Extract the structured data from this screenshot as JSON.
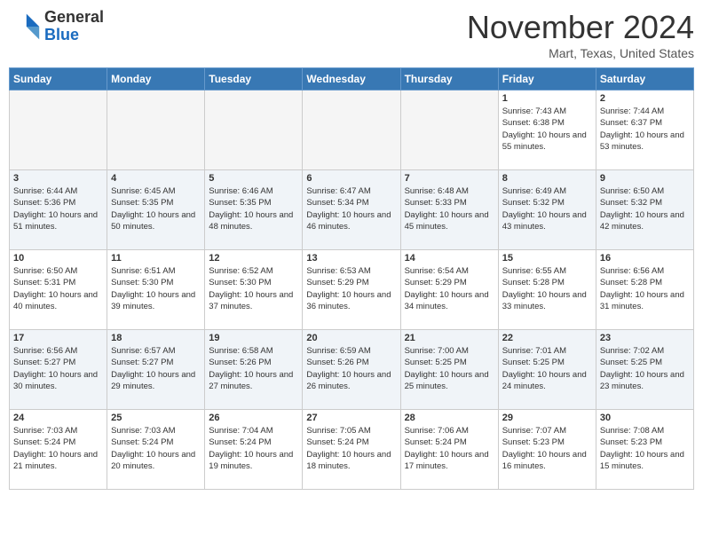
{
  "header": {
    "logo_general": "General",
    "logo_blue": "Blue",
    "month_title": "November 2024",
    "location": "Mart, Texas, United States"
  },
  "days_of_week": [
    "Sunday",
    "Monday",
    "Tuesday",
    "Wednesday",
    "Thursday",
    "Friday",
    "Saturday"
  ],
  "weeks": [
    [
      {
        "day": "",
        "empty": true
      },
      {
        "day": "",
        "empty": true
      },
      {
        "day": "",
        "empty": true
      },
      {
        "day": "",
        "empty": true
      },
      {
        "day": "",
        "empty": true
      },
      {
        "day": "1",
        "sunrise": "7:43 AM",
        "sunset": "6:38 PM",
        "daylight": "10 hours and 55 minutes."
      },
      {
        "day": "2",
        "sunrise": "7:44 AM",
        "sunset": "6:37 PM",
        "daylight": "10 hours and 53 minutes."
      }
    ],
    [
      {
        "day": "3",
        "sunrise": "6:44 AM",
        "sunset": "5:36 PM",
        "daylight": "10 hours and 51 minutes."
      },
      {
        "day": "4",
        "sunrise": "6:45 AM",
        "sunset": "5:35 PM",
        "daylight": "10 hours and 50 minutes."
      },
      {
        "day": "5",
        "sunrise": "6:46 AM",
        "sunset": "5:35 PM",
        "daylight": "10 hours and 48 minutes."
      },
      {
        "day": "6",
        "sunrise": "6:47 AM",
        "sunset": "5:34 PM",
        "daylight": "10 hours and 46 minutes."
      },
      {
        "day": "7",
        "sunrise": "6:48 AM",
        "sunset": "5:33 PM",
        "daylight": "10 hours and 45 minutes."
      },
      {
        "day": "8",
        "sunrise": "6:49 AM",
        "sunset": "5:32 PM",
        "daylight": "10 hours and 43 minutes."
      },
      {
        "day": "9",
        "sunrise": "6:50 AM",
        "sunset": "5:32 PM",
        "daylight": "10 hours and 42 minutes."
      }
    ],
    [
      {
        "day": "10",
        "sunrise": "6:50 AM",
        "sunset": "5:31 PM",
        "daylight": "10 hours and 40 minutes."
      },
      {
        "day": "11",
        "sunrise": "6:51 AM",
        "sunset": "5:30 PM",
        "daylight": "10 hours and 39 minutes."
      },
      {
        "day": "12",
        "sunrise": "6:52 AM",
        "sunset": "5:30 PM",
        "daylight": "10 hours and 37 minutes."
      },
      {
        "day": "13",
        "sunrise": "6:53 AM",
        "sunset": "5:29 PM",
        "daylight": "10 hours and 36 minutes."
      },
      {
        "day": "14",
        "sunrise": "6:54 AM",
        "sunset": "5:29 PM",
        "daylight": "10 hours and 34 minutes."
      },
      {
        "day": "15",
        "sunrise": "6:55 AM",
        "sunset": "5:28 PM",
        "daylight": "10 hours and 33 minutes."
      },
      {
        "day": "16",
        "sunrise": "6:56 AM",
        "sunset": "5:28 PM",
        "daylight": "10 hours and 31 minutes."
      }
    ],
    [
      {
        "day": "17",
        "sunrise": "6:56 AM",
        "sunset": "5:27 PM",
        "daylight": "10 hours and 30 minutes."
      },
      {
        "day": "18",
        "sunrise": "6:57 AM",
        "sunset": "5:27 PM",
        "daylight": "10 hours and 29 minutes."
      },
      {
        "day": "19",
        "sunrise": "6:58 AM",
        "sunset": "5:26 PM",
        "daylight": "10 hours and 27 minutes."
      },
      {
        "day": "20",
        "sunrise": "6:59 AM",
        "sunset": "5:26 PM",
        "daylight": "10 hours and 26 minutes."
      },
      {
        "day": "21",
        "sunrise": "7:00 AM",
        "sunset": "5:25 PM",
        "daylight": "10 hours and 25 minutes."
      },
      {
        "day": "22",
        "sunrise": "7:01 AM",
        "sunset": "5:25 PM",
        "daylight": "10 hours and 24 minutes."
      },
      {
        "day": "23",
        "sunrise": "7:02 AM",
        "sunset": "5:25 PM",
        "daylight": "10 hours and 23 minutes."
      }
    ],
    [
      {
        "day": "24",
        "sunrise": "7:03 AM",
        "sunset": "5:24 PM",
        "daylight": "10 hours and 21 minutes."
      },
      {
        "day": "25",
        "sunrise": "7:03 AM",
        "sunset": "5:24 PM",
        "daylight": "10 hours and 20 minutes."
      },
      {
        "day": "26",
        "sunrise": "7:04 AM",
        "sunset": "5:24 PM",
        "daylight": "10 hours and 19 minutes."
      },
      {
        "day": "27",
        "sunrise": "7:05 AM",
        "sunset": "5:24 PM",
        "daylight": "10 hours and 18 minutes."
      },
      {
        "day": "28",
        "sunrise": "7:06 AM",
        "sunset": "5:24 PM",
        "daylight": "10 hours and 17 minutes."
      },
      {
        "day": "29",
        "sunrise": "7:07 AM",
        "sunset": "5:23 PM",
        "daylight": "10 hours and 16 minutes."
      },
      {
        "day": "30",
        "sunrise": "7:08 AM",
        "sunset": "5:23 PM",
        "daylight": "10 hours and 15 minutes."
      }
    ]
  ]
}
